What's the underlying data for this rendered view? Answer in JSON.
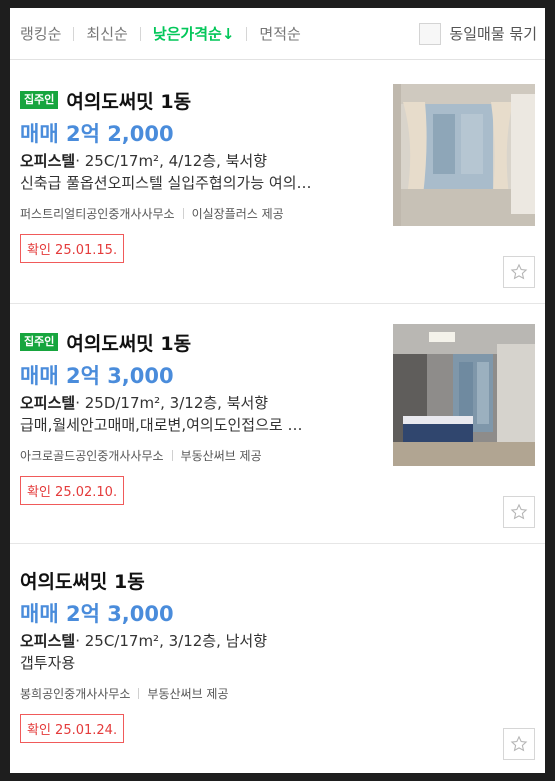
{
  "sort_bar": {
    "items": [
      {
        "label": "랭킹순",
        "active": false
      },
      {
        "label": "최신순",
        "active": false
      },
      {
        "label": "낮은가격순↓",
        "active": true
      },
      {
        "label": "면적순",
        "active": false
      }
    ],
    "group_toggle_label": "동일매물 묶기"
  },
  "listings": [
    {
      "badge": "집주인",
      "title": "여의도써밋 1동",
      "price": "매매 2억 2,000",
      "property_type": "오피스텔",
      "details": "· 25C/17m², 4/12층, 북서향",
      "description": "신축급 풀옵션오피스텔 실입주협의가능 여의…",
      "agency": "퍼스트리얼티공인중개사사무소",
      "provider": "이실장플러스 제공",
      "confirmed": "확인 25.01.15.",
      "has_photo": true,
      "photo_icon": "apartment-interior-photo"
    },
    {
      "badge": "집주인",
      "title": "여의도써밋 1동",
      "price": "매매 2억 3,000",
      "property_type": "오피스텔",
      "details": "· 25D/17m², 3/12층, 북서향",
      "description": "급매,월세안고매매,대로변,여의도인접으로 …",
      "agency": "아크로골드공인중개사사무소",
      "provider": "부동산써브 제공",
      "confirmed": "확인 25.02.10.",
      "has_photo": true,
      "photo_icon": "bedroom-interior-photo"
    },
    {
      "badge": "",
      "title": "여의도써밋 1동",
      "price": "매매 2억 3,000",
      "property_type": "오피스텔",
      "details": "· 25C/17m², 3/12층, 남서향",
      "description": "갭투자용",
      "agency": "봉희공인중개사사무소",
      "provider": "부동산써브 제공",
      "confirmed": "확인 25.01.24.",
      "has_photo": false
    }
  ],
  "colors": {
    "accent_green": "#03c75a",
    "price_blue": "#4a8cdb",
    "badge_green": "#17a53e",
    "confirm_red": "#e43b3b"
  }
}
